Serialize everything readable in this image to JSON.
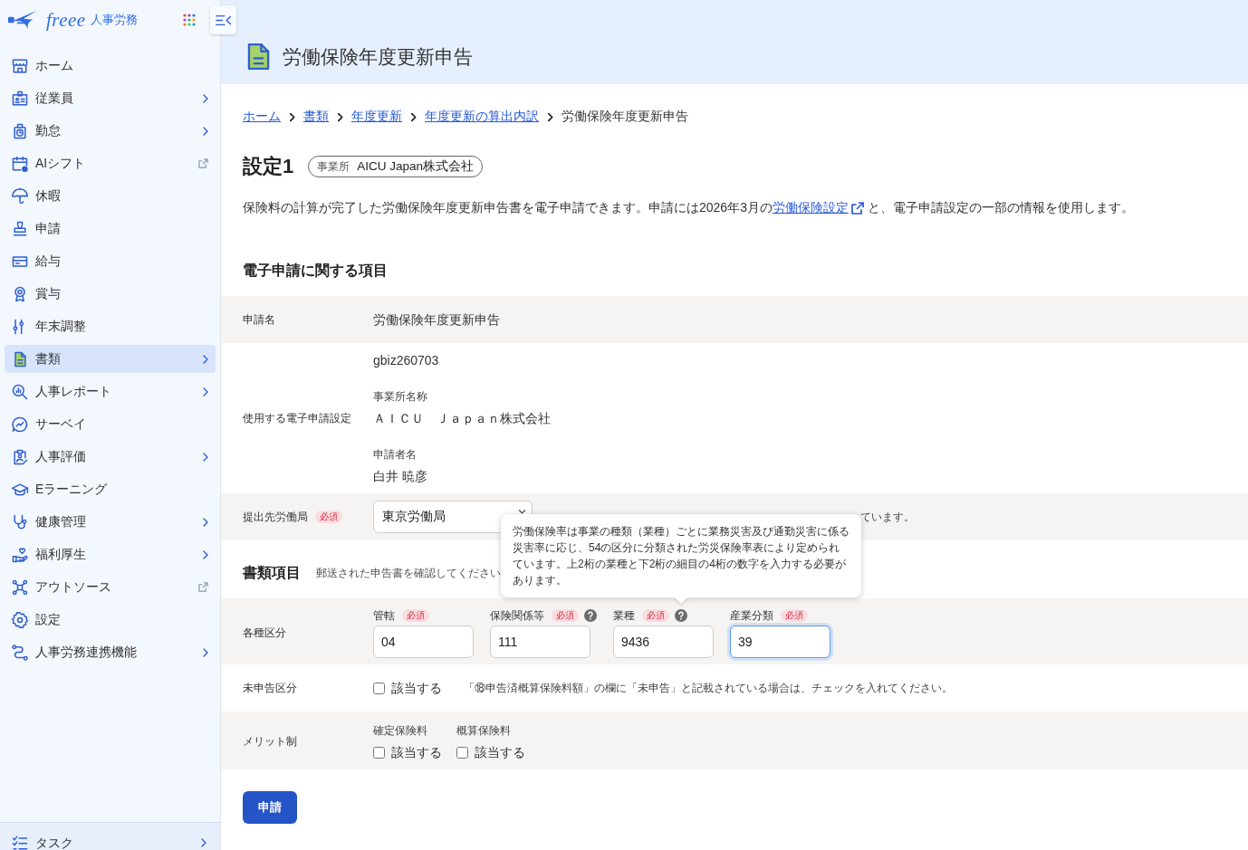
{
  "sidebar": {
    "logo": {
      "brand": "freee",
      "product": "人事労務"
    },
    "items": [
      {
        "label": "ホーム",
        "selected": false,
        "submenu": false,
        "external": false
      },
      {
        "label": "従業員",
        "selected": false,
        "submenu": true,
        "external": false
      },
      {
        "label": "勤怠",
        "selected": false,
        "submenu": true,
        "external": false
      },
      {
        "label": "AIシフト",
        "selected": false,
        "submenu": false,
        "external": true
      },
      {
        "label": "休暇",
        "selected": false,
        "submenu": false,
        "external": false
      },
      {
        "label": "申請",
        "selected": false,
        "submenu": false,
        "external": false
      },
      {
        "label": "給与",
        "selected": false,
        "submenu": false,
        "external": false
      },
      {
        "label": "賞与",
        "selected": false,
        "submenu": false,
        "external": false
      },
      {
        "label": "年末調整",
        "selected": false,
        "submenu": false,
        "external": false
      },
      {
        "label": "書類",
        "selected": true,
        "submenu": true,
        "external": false
      },
      {
        "label": "人事レポート",
        "selected": false,
        "submenu": true,
        "external": false
      },
      {
        "label": "サーベイ",
        "selected": false,
        "submenu": false,
        "external": false
      },
      {
        "label": "人事評価",
        "selected": false,
        "submenu": true,
        "external": false
      },
      {
        "label": "Eラーニング",
        "selected": false,
        "submenu": false,
        "external": false
      },
      {
        "label": "健康管理",
        "selected": false,
        "submenu": true,
        "external": false
      },
      {
        "label": "福利厚生",
        "selected": false,
        "submenu": true,
        "external": false
      },
      {
        "label": "アウトソース",
        "selected": false,
        "submenu": false,
        "external": true
      },
      {
        "label": "設定",
        "selected": false,
        "submenu": false,
        "external": false
      },
      {
        "label": "人事労務連携機能",
        "selected": false,
        "submenu": true,
        "external": false
      }
    ],
    "footer_item": {
      "label": "タスク",
      "submenu": true
    }
  },
  "header": {
    "title": "労働保険年度更新申告"
  },
  "breadcrumb": [
    {
      "label": "ホーム",
      "link": true
    },
    {
      "label": "書類",
      "link": true
    },
    {
      "label": "年度更新",
      "link": true
    },
    {
      "label": "年度更新の算出内訳",
      "link": true
    },
    {
      "label": "労働保険年度更新申告",
      "link": false
    }
  ],
  "setting": {
    "title": "設定1",
    "badge": {
      "label": "事業所",
      "value": "AICU Japan株式会社"
    }
  },
  "intro": {
    "before": "保険料の計算が完了した労働保険年度更新申告書を電子申請できます。申請には2026年3月の",
    "link": "労働保険設定",
    "after": "と、電子申請設定の一部の情報を使用します。"
  },
  "sections": [
    {
      "title": "電子申請に関する項目",
      "rows": [
        {
          "kind": "text",
          "label": "申請名",
          "value": "労働保険年度更新申告"
        },
        {
          "kind": "stack",
          "label": "使用する電子申請設定",
          "entries": [
            {
              "value": "gbiz260703"
            },
            {
              "caption": "事業所名称",
              "value": "ＡＩＣＵ　Ｊａｐａｎ株式会社"
            },
            {
              "caption": "申請者名",
              "value": "白井 暁彦"
            }
          ]
        },
        {
          "kind": "select",
          "label": "提出先労働局",
          "required": "必須",
          "value": "東京労働局",
          "hint": "ています。"
        }
      ]
    },
    {
      "title": "書類項目",
      "subtitle": "郵送された申告書を確認してください",
      "rows": [
        {
          "kind": "fields",
          "label": "各種区分",
          "fields": [
            {
              "label": "管轄",
              "required": "必須",
              "help": false,
              "focused": false,
              "value": "04"
            },
            {
              "label": "保険関係等",
              "required": "必須",
              "help": true,
              "focused": false,
              "value": "111"
            },
            {
              "label": "業種",
              "required": "必須",
              "help": true,
              "focused": false,
              "value": "9436",
              "tooltip": "労働保険率は事業の種類（業種）ごとに業務災害及び通勤災害に係る災害率に応じ、54の区分に分類された労災保険率表により定められています。上2桁の業種と下2桁の細目の4桁の数字を入力する必要があります。"
            },
            {
              "label": "産業分類",
              "required": "必須",
              "help": false,
              "focused": true,
              "value": "39"
            }
          ]
        },
        {
          "kind": "checkbox",
          "label": "未申告区分",
          "option": "該当する",
          "checked": false,
          "hint": "「⑱申告済概算保険料額」の欄に「未申告」と記載されている場合は、チェックを入れてください。"
        },
        {
          "kind": "checkgroup",
          "label": "メリット制",
          "groups": [
            {
              "caption": "確定保険料",
              "option": "該当する",
              "checked": false
            },
            {
              "caption": "概算保険料",
              "option": "該当する",
              "checked": false
            }
          ]
        }
      ]
    }
  ],
  "submit": {
    "label": "申請"
  }
}
